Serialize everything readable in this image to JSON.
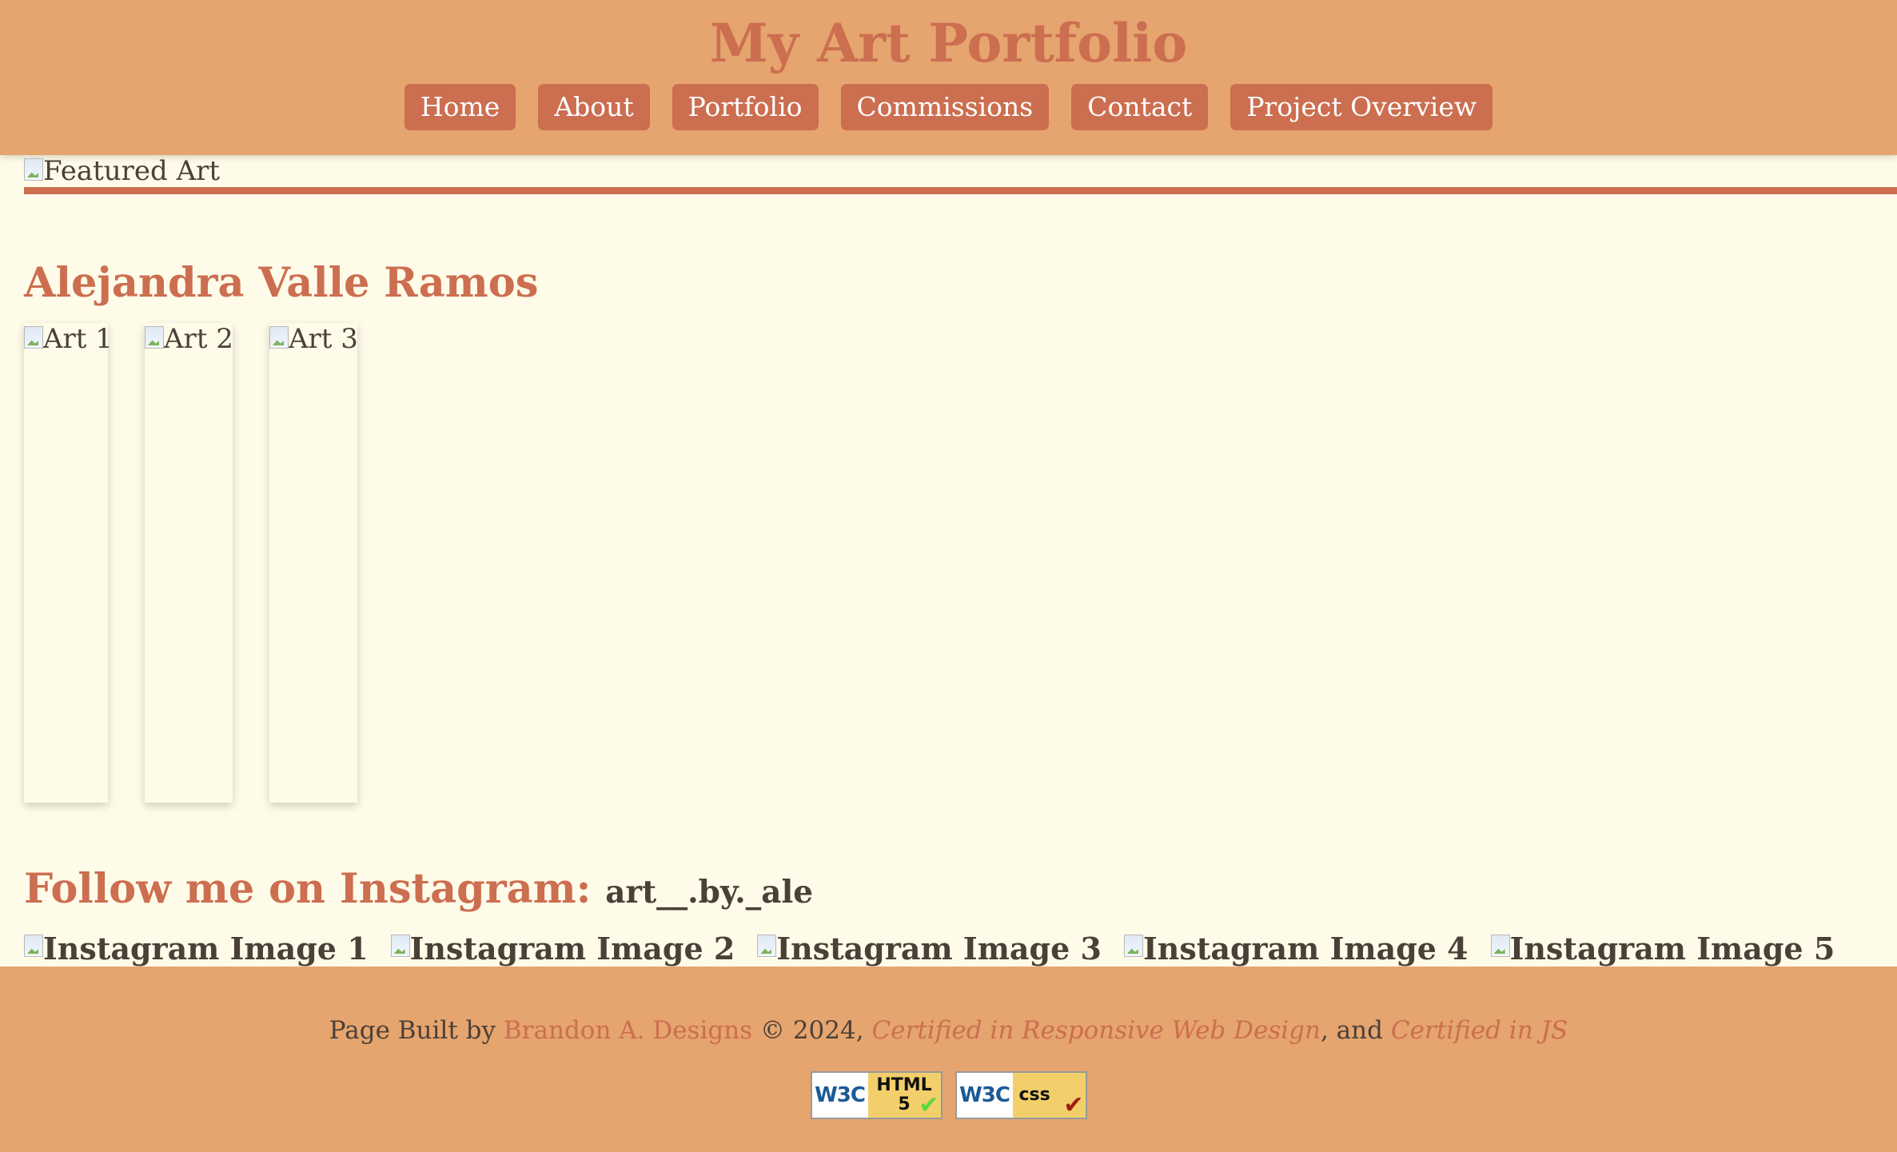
{
  "header": {
    "title": "My Art Portfolio",
    "nav": [
      "Home",
      "About",
      "Portfolio",
      "Commissions",
      "Contact",
      "Project Overview"
    ]
  },
  "featured": {
    "alt": "Featured Art"
  },
  "artist": {
    "name": "Alejandra Valle Ramos"
  },
  "gallery": {
    "items": [
      "Art 1",
      "Art 2",
      "Art 3"
    ]
  },
  "instagram": {
    "heading": "Follow me on Instagram:",
    "handle": "art__.by._ale",
    "images": [
      "Instagram Image 1",
      "Instagram Image 2",
      "Instagram Image 3",
      "Instagram Image 4",
      "Instagram Image 5"
    ]
  },
  "footer": {
    "prefix": "Page Built by",
    "designer": "Brandon A. Designs",
    "copyright": "© 2024,",
    "cert1": "Certified in Responsive Web Design",
    "and": ", and",
    "cert2": "Certified in JS",
    "badges": {
      "html": {
        "org": "W3C",
        "line1": "HTML",
        "line2": "5",
        "check_color": "#5fd63a"
      },
      "css": {
        "org": "W3C",
        "line1": "css",
        "check_color": "#a01c12"
      }
    }
  },
  "colors": {
    "header_bg": "#e6a46e",
    "accent": "#cc6e50",
    "page_bg": "#fefbe8",
    "text": "#4a4038"
  }
}
